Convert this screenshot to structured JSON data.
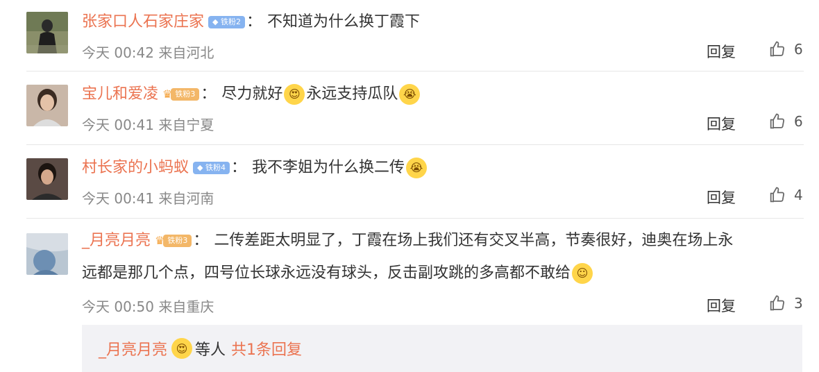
{
  "comments": [
    {
      "username": "张家口人石家庄家",
      "badge": "铁粉2",
      "badge_style": "blue",
      "content_lines": [
        "不知道为什么换丁霞下"
      ],
      "time": "今天 00:42",
      "location": "来自河北",
      "reply_label": "回复",
      "likes": "6"
    },
    {
      "username": "宝儿和爱凌",
      "badge": "铁粉3",
      "badge_style": "gold",
      "content_parts": [
        "尽力就好",
        "永远支持瓜队"
      ],
      "emojis": [
        "heart-eyes-emoji",
        "crying-emoji"
      ],
      "time": "今天 00:41",
      "location": "来自宁夏",
      "reply_label": "回复",
      "likes": "6"
    },
    {
      "username": "村长家的小蚂蚁",
      "badge": "铁粉4",
      "badge_style": "blue",
      "content_lines": [
        "我不李姐为什么换二传"
      ],
      "emojis": [
        "crying-emoji"
      ],
      "time": "今天 00:41",
      "location": "来自河南",
      "reply_label": "回复",
      "likes": "4"
    },
    {
      "username": "_月亮月亮",
      "badge": "铁粉3",
      "badge_style": "gold",
      "content_lines": [
        "二传差距太明显了，丁霞在场上我们还有交叉半高，节奏很好，迪奥在场上永",
        "远都是那几个点，四号位长球永远没有球头，反击副攻跳的多高都不敢给"
      ],
      "emojis": [
        "smile-emoji"
      ],
      "time": "今天 00:50",
      "location": "来自重庆",
      "reply_label": "回复",
      "likes": "3"
    }
  ],
  "sub_reply": {
    "username": "_月亮月亮",
    "middle": "等人",
    "total": "共1条回复"
  },
  "colors": {
    "username": "#eb7350",
    "meta": "#888888",
    "badge_blue": "#86b3f0",
    "badge_gold": "#f3b768"
  }
}
